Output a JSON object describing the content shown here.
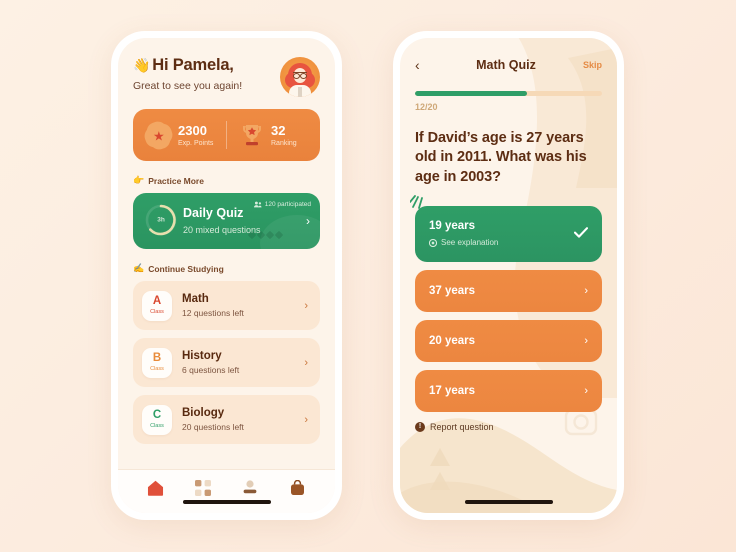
{
  "theme": {
    "bg_start": "#fdf1e4",
    "bg_end": "#fbe6d6",
    "orange": "#ef8b43",
    "green": "#2f9e67",
    "brown": "#5d2d13",
    "card_peach": "#fbe7d3"
  },
  "home": {
    "greeting_wave": "👋",
    "greeting": "Hi Pamela,",
    "subtitle": "Great to see you again!",
    "avatar_name": "pamela-avatar",
    "stats": [
      {
        "icon": "star-badge-icon",
        "value": "2300",
        "label": "Exp. Points"
      },
      {
        "icon": "trophy-icon",
        "value": "32",
        "label": "Ranking"
      }
    ],
    "sections": [
      {
        "icon": "pointing-hand-icon",
        "label": "Practice More"
      },
      {
        "icon": "writing-hand-icon",
        "label": "Continue Studying"
      }
    ],
    "daily_quiz": {
      "ring_label": "3h",
      "ring_percent": 62,
      "title": "Daily Quiz",
      "subtitle": "20 mixed questions",
      "participants": "120 participated",
      "participants_icon": "people-icon",
      "chevron": "›"
    },
    "subjects": [
      {
        "grade": "A",
        "class_label": "Class",
        "grade_color": "#d9482f",
        "name": "Math",
        "meta": "12 questions left",
        "chevron": "›"
      },
      {
        "grade": "B",
        "class_label": "Class",
        "grade_color": "#e88b3a",
        "name": "History",
        "meta": "6 questions left",
        "chevron": "›"
      },
      {
        "grade": "C",
        "class_label": "Class",
        "grade_color": "#2f9e67",
        "name": "Biology",
        "meta": "20 questions left",
        "chevron": "›"
      }
    ],
    "tabbar": [
      {
        "icon": "home-icon",
        "active": true
      },
      {
        "icon": "grid-icon",
        "active": false
      },
      {
        "icon": "person-icon",
        "active": false
      },
      {
        "icon": "bag-icon",
        "active": false
      }
    ]
  },
  "quiz": {
    "back_icon": "chevron-left-icon",
    "title": "Math Quiz",
    "skip_label": "Skip",
    "progress": {
      "current": "12",
      "separator": "/",
      "total": "20",
      "percent": 60
    },
    "question": "If David’s age is 27 years old in 2011. What was his age in 2003?",
    "options": [
      {
        "label": "19  years",
        "state": "correct",
        "explanation": "See explanation",
        "explanation_icon": "eye-icon",
        "trailing": "check-icon"
      },
      {
        "label": "37 years",
        "state": "default",
        "trailing": "›"
      },
      {
        "label": "20 years",
        "state": "default",
        "trailing": "›"
      },
      {
        "label": "17 years",
        "state": "default",
        "trailing": "›"
      }
    ],
    "report": {
      "icon": "info-icon",
      "icon_glyph": "!",
      "label": "Report question"
    }
  }
}
